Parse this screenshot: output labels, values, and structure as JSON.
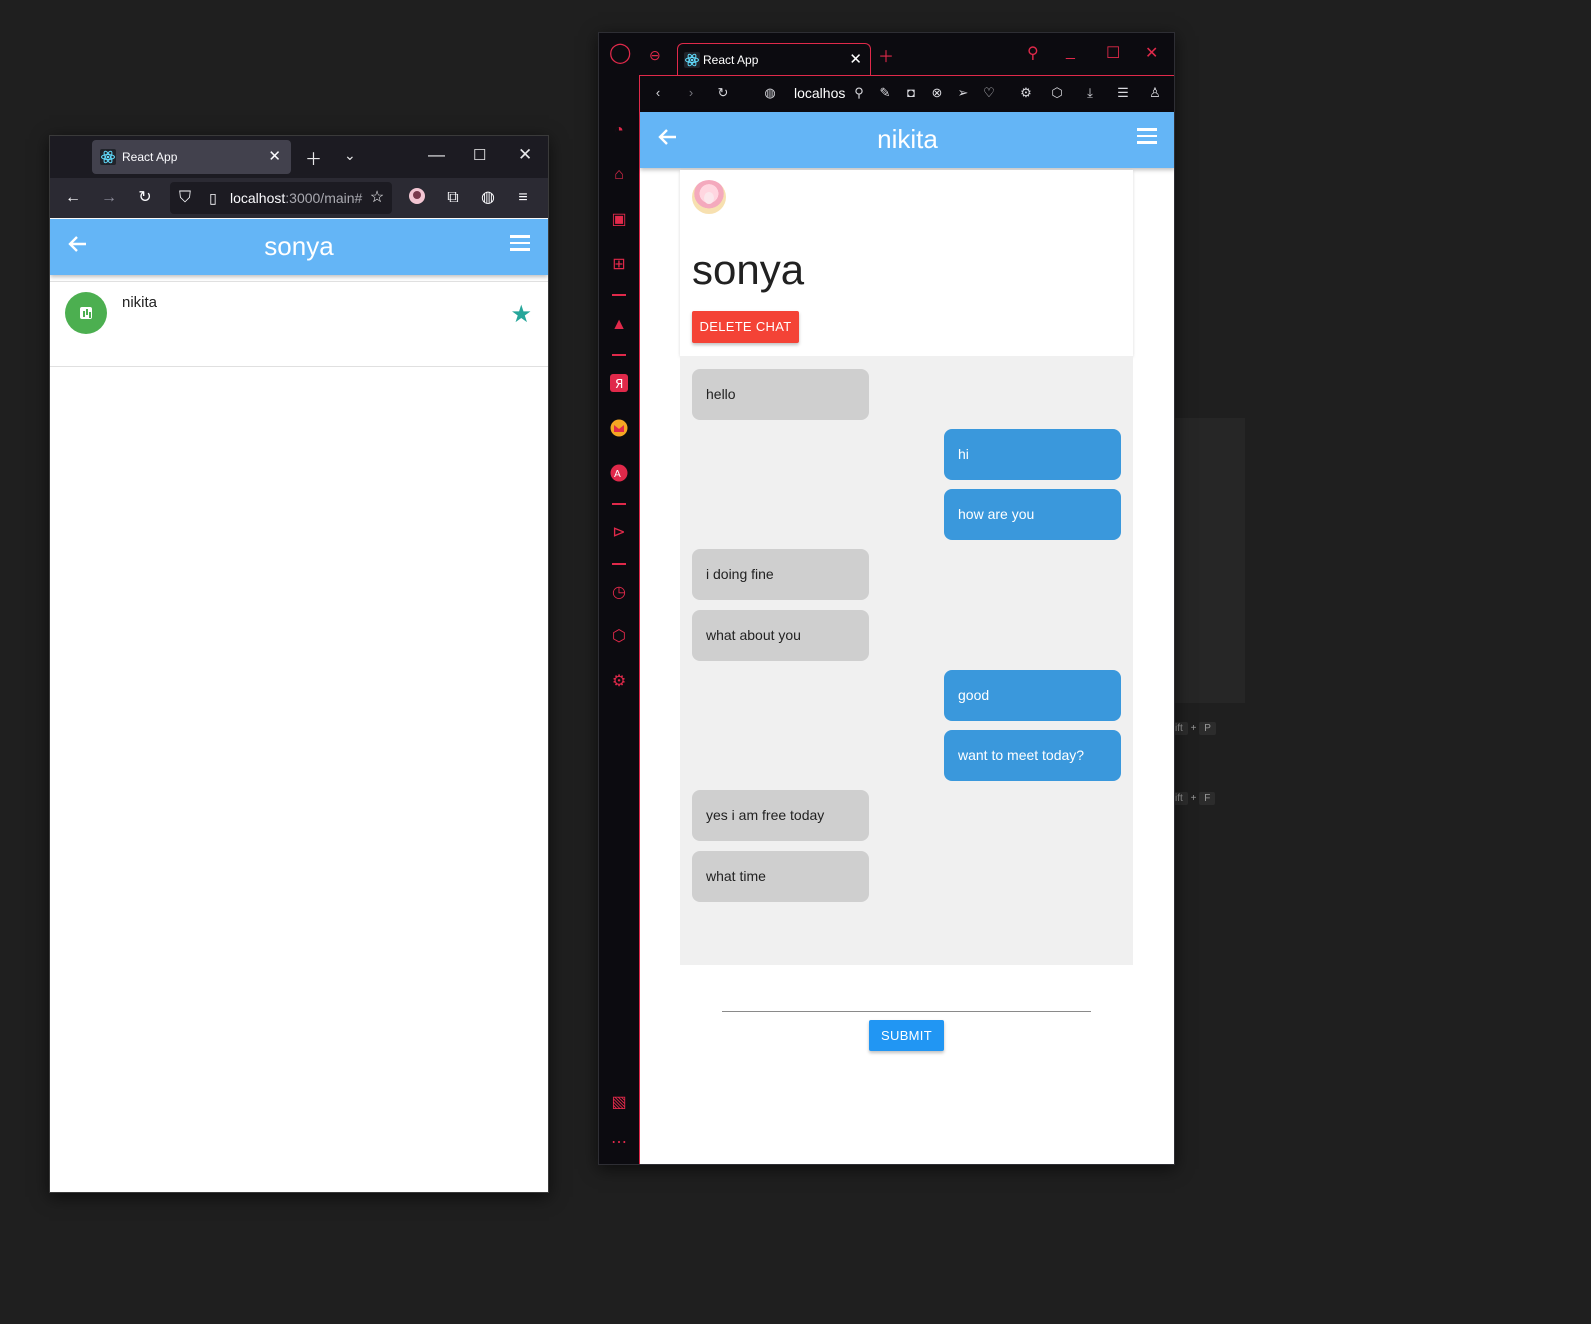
{
  "firefox": {
    "tab_title": "React App",
    "url_host": "localhost",
    "url_path": ":3000/main#",
    "app": {
      "title": "sonya",
      "contacts": [
        {
          "name": "nikita",
          "favorite": true
        }
      ]
    }
  },
  "opera": {
    "tab_title": "React App",
    "url_host": "localhos",
    "app": {
      "title": "nikita",
      "chat_user": "sonya",
      "delete_button": "DELETE CHAT",
      "submit_button": "SUBMIT",
      "input_value": "",
      "messages": [
        {
          "text": "hello",
          "side": "in"
        },
        {
          "text": "hi",
          "side": "out"
        },
        {
          "text": "how are you",
          "side": "out"
        },
        {
          "text": "i doing fine",
          "side": "in"
        },
        {
          "text": "what about you",
          "side": "in"
        },
        {
          "text": "good",
          "side": "out"
        },
        {
          "text": "want to meet today?",
          "side": "out"
        },
        {
          "text": "yes i am free today",
          "side": "in"
        },
        {
          "text": "what time",
          "side": "in"
        }
      ]
    }
  },
  "background_shortcuts": [
    {
      "prefix": "ift",
      "plus": "+",
      "key": "P"
    },
    {
      "prefix": "ift",
      "plus": "+",
      "key": "F"
    }
  ],
  "colors": {
    "app_bar": "#64b5f6",
    "incoming": "#cfcfcf",
    "outgoing": "#3a98dc",
    "delete": "#f44336",
    "submit": "#2196f3",
    "opera_accent": "#e0294a"
  }
}
